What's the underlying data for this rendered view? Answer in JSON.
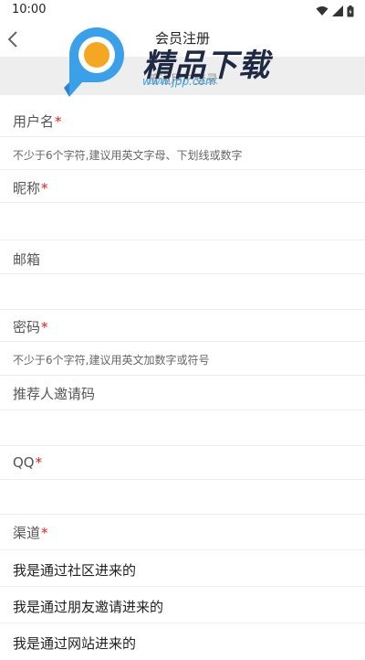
{
  "status_bar": {
    "time": "10:00",
    "icons": [
      "wifi-icon",
      "signal-icon",
      "battery-icon"
    ]
  },
  "header": {
    "title": "会员注册",
    "back_icon": "chevron-left-icon"
  },
  "subtab": {
    "label": "普通用户登录"
  },
  "watermark": {
    "logo_text": "精品下载",
    "url": "www.jpp.com"
  },
  "form": {
    "username": {
      "label": "用户名",
      "required": "*",
      "placeholder": "不少于6个字符,建议用英文字母、下划线或数字"
    },
    "nickname": {
      "label": "昵称",
      "required": "*",
      "placeholder": ""
    },
    "email": {
      "label": "邮箱",
      "placeholder": ""
    },
    "password": {
      "label": "密码",
      "required": "*",
      "placeholder": "不少于6个字符,建议用英文加数字或符号"
    },
    "referral": {
      "label": "推荐人邀请码",
      "placeholder": ""
    },
    "qq": {
      "label": "QQ",
      "required": "*",
      "placeholder": ""
    },
    "channel": {
      "label": "渠道",
      "required": "*",
      "options": [
        "我是通过社区进来的",
        "我是通过朋友邀请进来的",
        "我是通过网站进来的"
      ]
    }
  },
  "colors": {
    "required": "#e02020",
    "divider": "#eeeeee",
    "subtab_bg": "#eeeeee",
    "watermark_blue": "#3ba0e8",
    "watermark_orange": "#f5a623"
  }
}
